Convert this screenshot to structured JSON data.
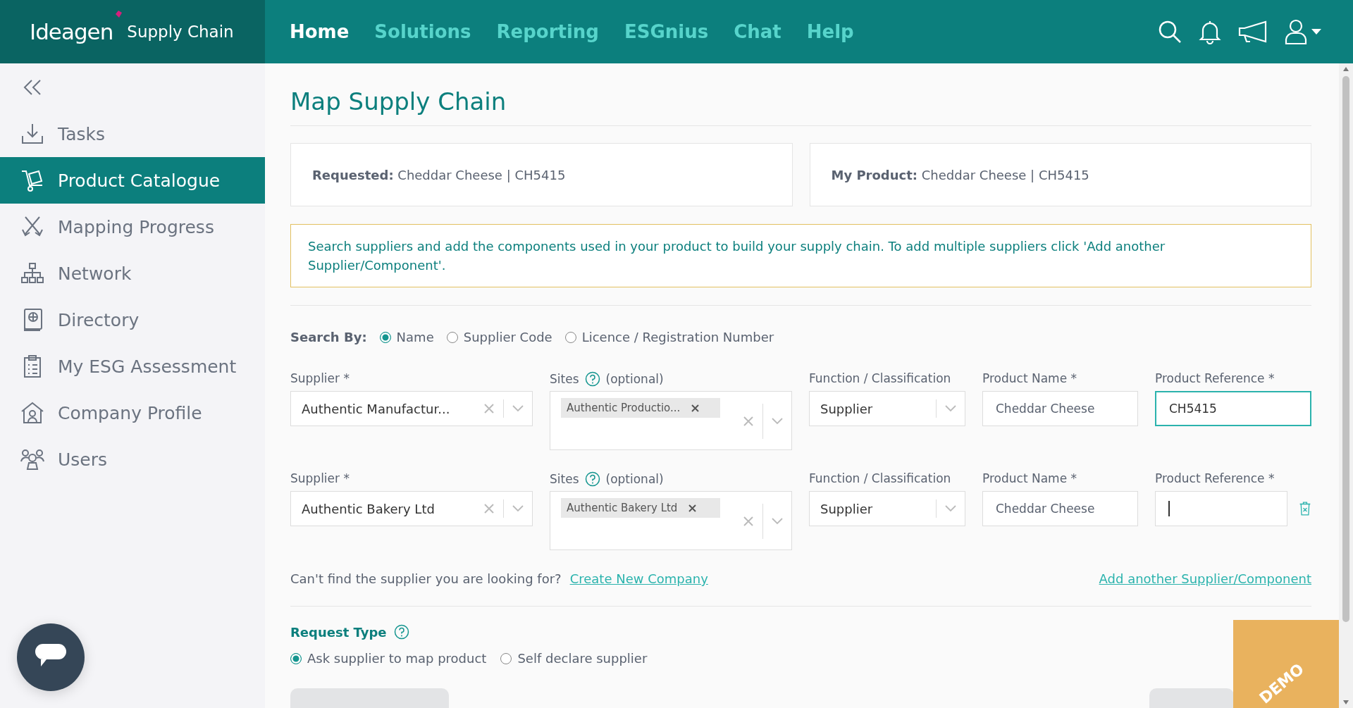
{
  "brand": {
    "name": "Ideagen",
    "product": "Supply Chain"
  },
  "nav": [
    {
      "label": "Home",
      "selected": true
    },
    {
      "label": "Solutions",
      "selected": false
    },
    {
      "label": "Reporting",
      "selected": false
    },
    {
      "label": "ESGnius",
      "selected": false
    },
    {
      "label": "Chat",
      "selected": false
    },
    {
      "label": "Help",
      "selected": false
    }
  ],
  "sidebar": {
    "items": [
      {
        "label": "Tasks",
        "selected": false
      },
      {
        "label": "Product Catalogue",
        "selected": true
      },
      {
        "label": "Mapping Progress",
        "selected": false
      },
      {
        "label": "Network",
        "selected": false
      },
      {
        "label": "Directory",
        "selected": false
      },
      {
        "label": "My ESG Assessment",
        "selected": false
      },
      {
        "label": "Company Profile",
        "selected": false
      },
      {
        "label": "Users",
        "selected": false
      }
    ]
  },
  "page": {
    "title": "Map Supply Chain"
  },
  "summary": [
    {
      "label": "Requested:",
      "value": "Cheddar Cheese | CH5415"
    },
    {
      "label": "My Product:",
      "value": "Cheddar Cheese | CH5415"
    }
  ],
  "notice": "Search suppliers and add the components used in your product to build your supply chain. To add multiple suppliers click 'Add another Supplier/Component'.",
  "search_by": {
    "label": "Search By:",
    "options": [
      {
        "label": "Name",
        "selected": true
      },
      {
        "label": "Supplier Code",
        "selected": false
      },
      {
        "label": "Licence / Registration Number",
        "selected": false
      }
    ]
  },
  "components": [
    {
      "supplier_label": "Supplier *",
      "supplier": "Authentic Manufactur...",
      "sites_label": "Sites",
      "sites_hint": "(optional)",
      "site_tag": "Authentic Productio...",
      "function_label": "Function / Classification",
      "function": "Supplier",
      "product_name_label": "Product Name *",
      "product_name": "Cheddar Cheese",
      "product_reference_label": "Product Reference *",
      "product_reference": "CH5415",
      "highlighted": true,
      "caret": false,
      "removable": false
    },
    {
      "supplier_label": "Supplier *",
      "supplier": "Authentic Bakery Ltd",
      "sites_label": "Sites",
      "sites_hint": "(optional)",
      "site_tag": "Authentic Bakery Ltd",
      "function_label": "Function / Classification",
      "function": "Supplier",
      "product_name_label": "Product Name *",
      "product_name": "Cheddar Cheese",
      "product_reference_label": "Product Reference *",
      "highlighted": false,
      "caret": true,
      "removable": true
    }
  ],
  "cant_find": {
    "text": "Can't find the supplier you are looking for?",
    "link": "Create New Company"
  },
  "add_link": "Add another Supplier/Component",
  "request_type": {
    "label": "Request Type",
    "options": [
      {
        "label": "Ask supplier to map product",
        "selected": true
      },
      {
        "label": "Self declare supplier",
        "selected": false
      }
    ]
  },
  "demo_ribbon": "DEMO"
}
